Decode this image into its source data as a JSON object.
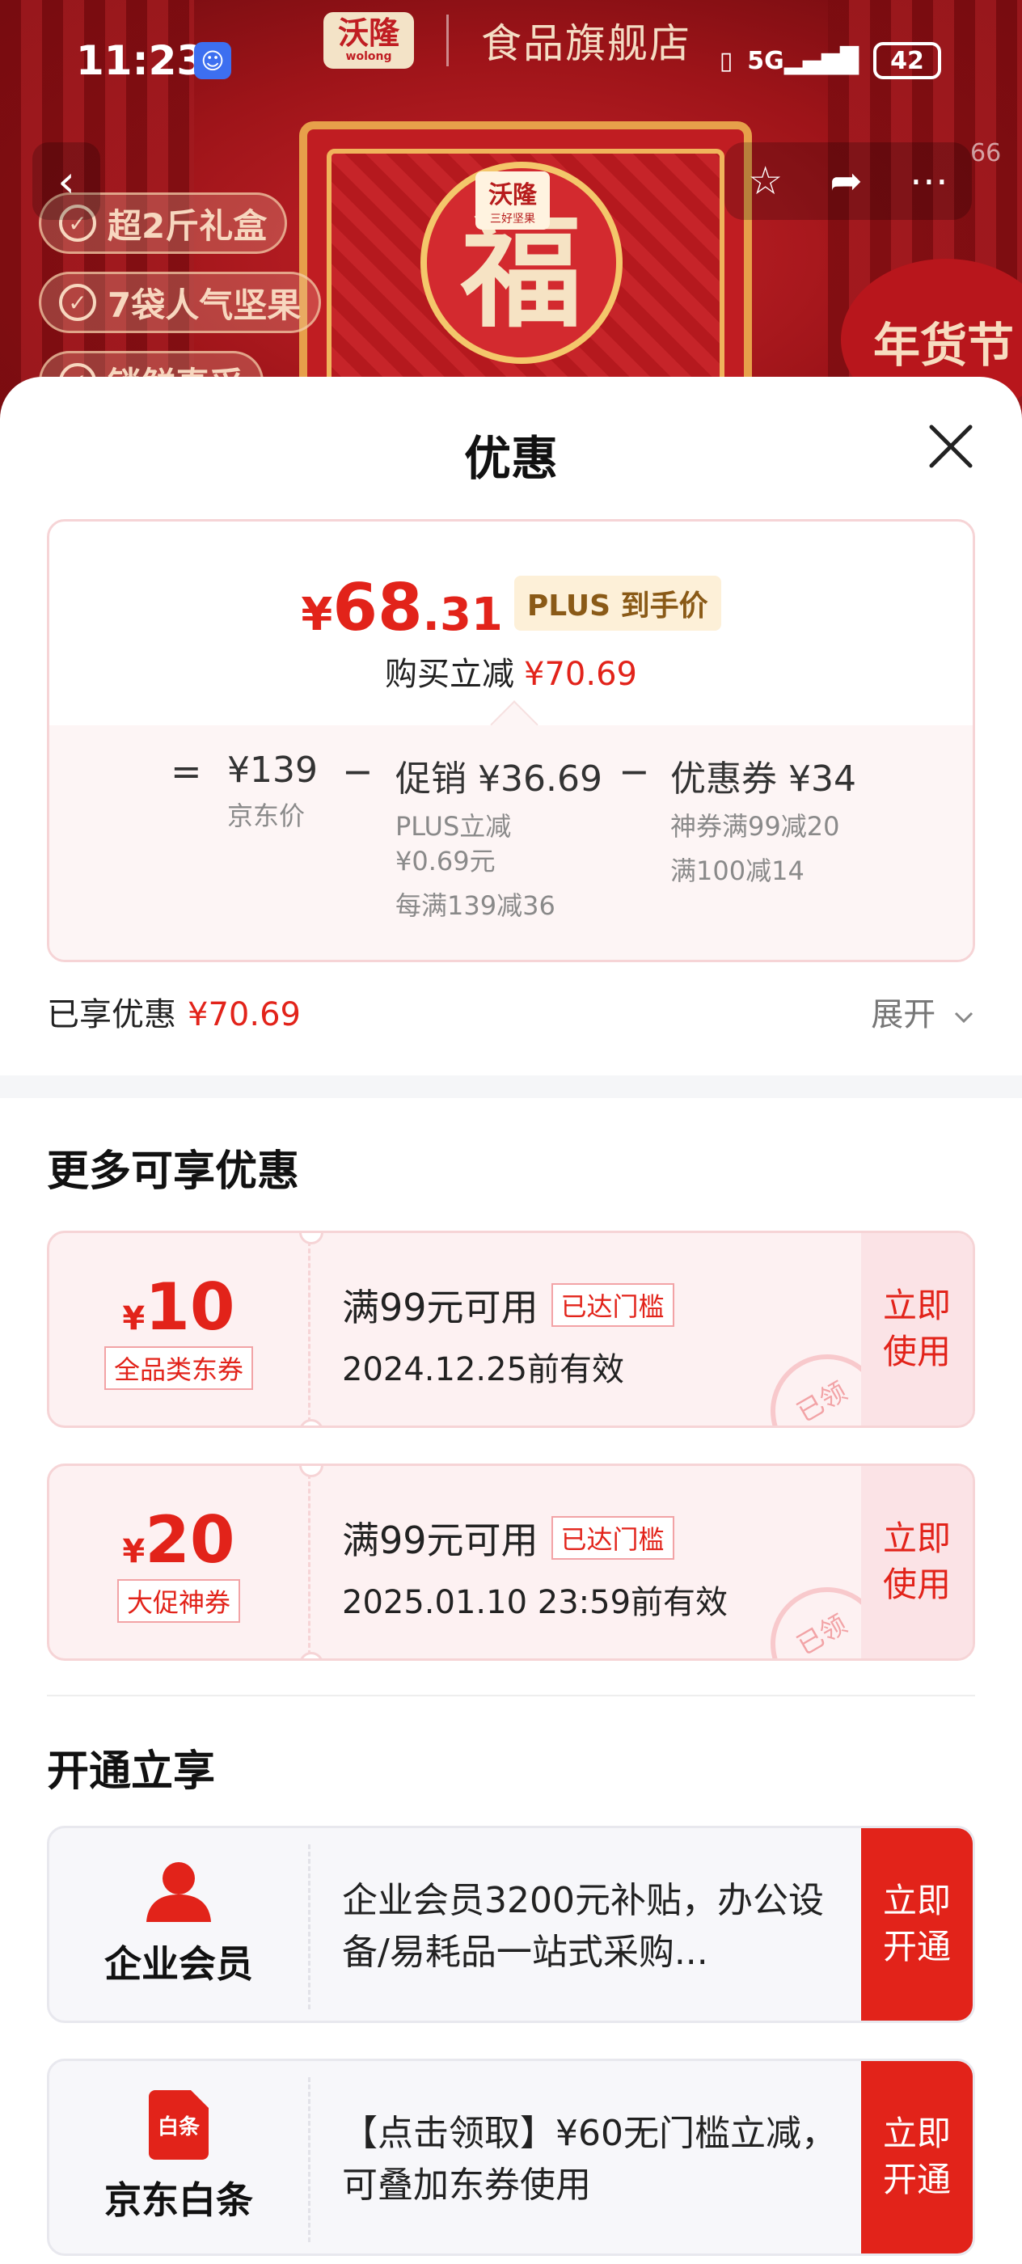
{
  "status_bar": {
    "time": "11:23",
    "signal": "5G",
    "battery": "42"
  },
  "store": {
    "brand": "沃隆",
    "brand_sub": "wolong",
    "name": "食品旗舰店",
    "badge_count": "66"
  },
  "product_tags": [
    "超2斤礼盒",
    "7袋人气坚果",
    "锁鲜真采"
  ],
  "product_art": {
    "seal_char": "福",
    "box_brand": "沃隆",
    "box_brand_sub": "三好坚果",
    "festival": "年货节"
  },
  "sheet": {
    "title": "优惠",
    "price": {
      "currency": "¥",
      "integer": "68",
      "decimal": ".31",
      "plus_label": "PLUS 到手价",
      "buy_reduce_label": "购买立减",
      "buy_reduce_value": "¥70.69"
    },
    "formula": {
      "eq": "=",
      "minus": "−",
      "jd_price": "¥139",
      "jd_price_label": "京东价",
      "promo_head": "促销 ¥36.69",
      "promo_sub1": "PLUS立减",
      "promo_sub2": "¥0.69元",
      "promo_sub3": "每满139减36",
      "coupon_head": "优惠券 ¥34",
      "coupon_sub1": "神券满99减20",
      "coupon_sub2": "满100减14"
    },
    "enjoyed_label": "已享优惠",
    "enjoyed_value": "¥70.69",
    "expand_label": "展开"
  },
  "more_offers": {
    "title": "更多可享优惠",
    "coupons": [
      {
        "currency": "¥",
        "value": "10",
        "category": "全品类东券",
        "condition": "满99元可用",
        "reached": "已达门槛",
        "expiry": "2024.12.25前有效",
        "stamp": "已领",
        "action": "立即\n使用"
      },
      {
        "currency": "¥",
        "value": "20",
        "category": "大促神券",
        "condition": "满99元可用",
        "reached": "已达门槛",
        "expiry": "2025.01.10 23:59前有效",
        "stamp": "已领",
        "action": "立即\n使用"
      }
    ]
  },
  "open_enjoy": {
    "title": "开通立享",
    "items": [
      {
        "name": "企业会员",
        "icon": "user-icon",
        "desc": "企业会员3200元补贴，办公设备/易耗品一站式采购...",
        "action": "立即\n开通"
      },
      {
        "name": "京东白条",
        "icon": "baitiao-icon",
        "icon_text": "白条",
        "desc": "【点击领取】¥60无门槛立减，可叠加东券使用",
        "action": "立即\n开通"
      }
    ]
  },
  "colors": {
    "accent_red": "#e2231a",
    "coupon_bg": "#fdf1f2",
    "plus_tag_bg": "#fdf0d8"
  }
}
